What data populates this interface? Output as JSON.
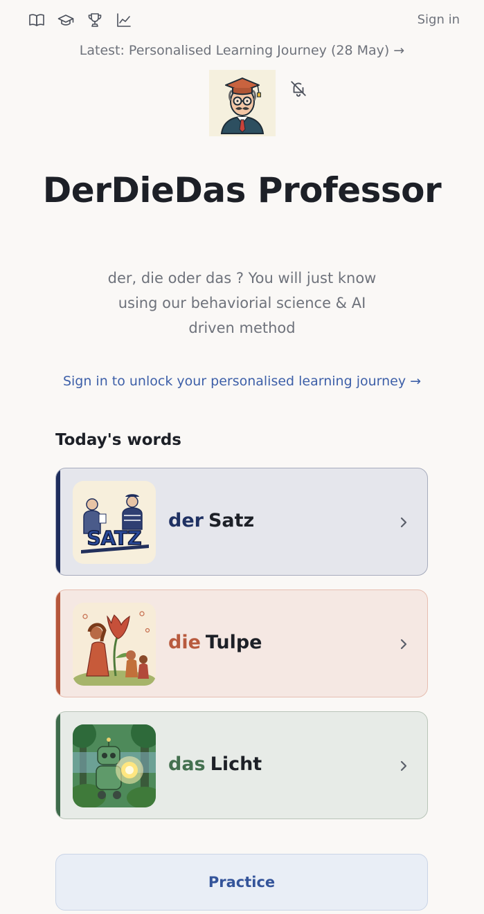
{
  "nav": {
    "icons": [
      "book-icon",
      "graduation-cap-icon",
      "trophy-icon",
      "chart-icon"
    ],
    "sign_in": "Sign in"
  },
  "latest": "Latest: Personalised Learning Journey (28 May) →",
  "avatar": "professor-avatar",
  "title": "DerDieDas Professor",
  "subtitle": "der, die oder das ? You will just know using our behaviorial science & AI driven method",
  "unlock_link": "Sign in to unlock your personalised learning journey →",
  "todays_words_title": "Today's words",
  "words": [
    {
      "article": "der",
      "noun": "Satz",
      "color": "#1e2d5c",
      "image": "satz-illustration"
    },
    {
      "article": "die",
      "noun": "Tulpe",
      "color": "#b5573b",
      "image": "tulpe-illustration"
    },
    {
      "article": "das",
      "noun": "Licht",
      "color": "#3e6b4b",
      "image": "licht-illustration"
    }
  ],
  "practice_button": "Practice",
  "colors": {
    "background": "#faf8f6",
    "link": "#3d5fa8",
    "der": "#1e2d5c",
    "die": "#b5573b",
    "das": "#3e6b4b"
  }
}
